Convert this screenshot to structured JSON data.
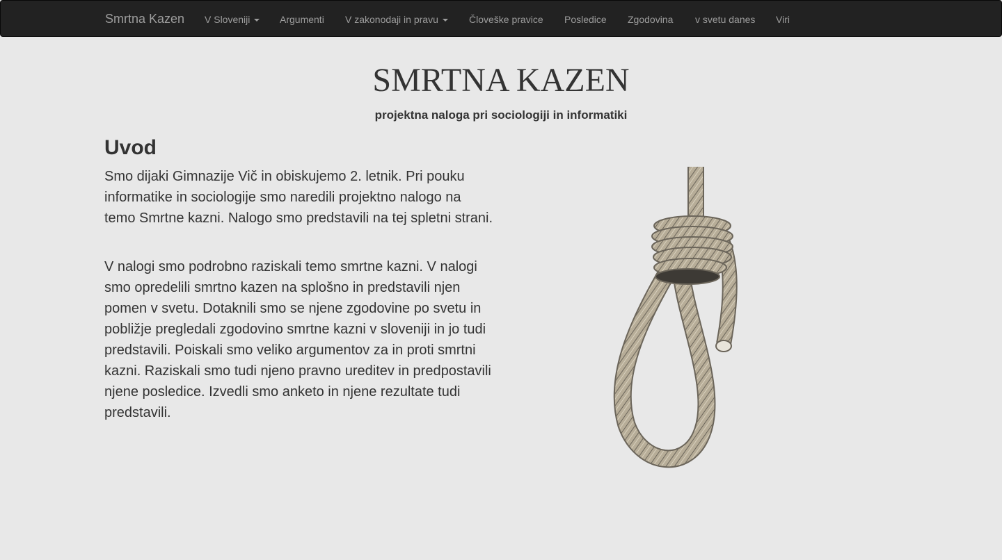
{
  "nav": {
    "brand": "Smrtna Kazen",
    "items": [
      {
        "label": "V Sloveniji",
        "dropdown": true
      },
      {
        "label": "Argumenti",
        "dropdown": false
      },
      {
        "label": "V zakonodaji in pravu",
        "dropdown": true
      },
      {
        "label": "Človeške pravice",
        "dropdown": false
      },
      {
        "label": "Posledice",
        "dropdown": false
      },
      {
        "label": "Zgodovina",
        "dropdown": false
      },
      {
        "label": "v svetu danes",
        "dropdown": false
      },
      {
        "label": "Viri",
        "dropdown": false
      }
    ]
  },
  "header": {
    "title": "SMRTNA KAZEN",
    "subtitle": "projektna naloga pri sociologiji in informatiki"
  },
  "intro": {
    "heading": "Uvod",
    "paragraphs": [
      "Smo dijaki Gimnazije Vič in obiskujemo 2. letnik. Pri pouku informatike in sociologije smo naredili projektno nalogo na temo Smrtne kazni. Nalogo smo predstavili na tej spletni strani.",
      "V nalogi smo podrobno raziskali temo smrtne kazni. V nalogi smo opredelili smrtno kazen na splošno in predstavili njen pomen v svetu. Dotaknili smo se njene zgodovine po svetu in pobližje pregledali zgodovino smrtne kazni v sloveniji in jo tudi predstavili. Poiskali smo veliko argumentov za in proti smrtni kazni. Raziskali smo tudi njeno pravno ureditev in predpostavili njene posledice. Izvedli smo anketo in njene rezultate tudi predstavili."
    ]
  },
  "image": {
    "icon": "noose-illustration",
    "rope_color": "#b7ad98",
    "rope_outline": "#6b655a"
  }
}
